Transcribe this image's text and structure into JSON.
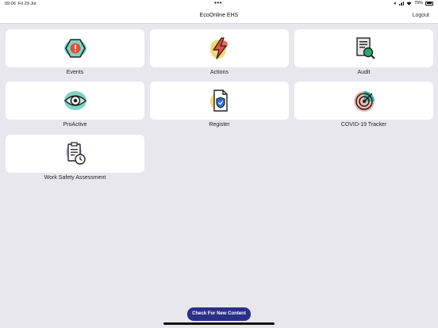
{
  "status_bar": {
    "time": "09:06",
    "date": "Fri 29 Jul",
    "battery": "79%"
  },
  "nav": {
    "title": "EcoOnline EHS",
    "logout_label": "Logout"
  },
  "tiles": [
    {
      "label": "Events",
      "icon": "hexagon-alert-icon",
      "accent": "#3fb8a8"
    },
    {
      "label": "Actions",
      "icon": "lightning-bolt-icon",
      "accent": "#f0b429"
    },
    {
      "label": "Audit",
      "icon": "clipboard-search-icon",
      "accent": "#2ea66b"
    },
    {
      "label": "ProActive",
      "icon": "eye-icon",
      "accent": "#3fb8a8"
    },
    {
      "label": "Register",
      "icon": "document-check-icon",
      "accent": "#f0b429"
    },
    {
      "label": "COVID-19 Tracker",
      "icon": "target-icon",
      "accent": "#e8827a"
    },
    {
      "label": "Work Safety Assessment",
      "icon": "clipboard-clock-icon",
      "accent": "#a99be0"
    }
  ],
  "footer": {
    "check_button_label": "Check For New Content"
  },
  "colors": {
    "background": "#e8e7ee",
    "button": "#2b2f86"
  }
}
